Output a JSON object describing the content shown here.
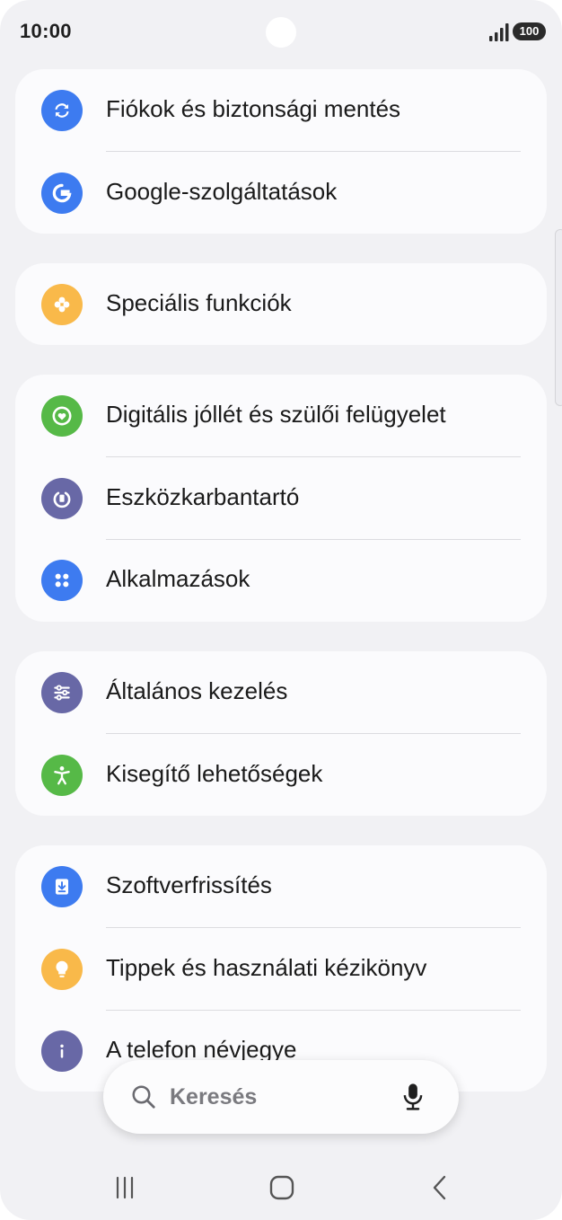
{
  "status_bar": {
    "time": "10:00",
    "battery": "100"
  },
  "groups": [
    {
      "items": [
        {
          "label": "Fiókok és biztonsági mentés",
          "icon": "sync-icon",
          "color": "#3d7bf0"
        },
        {
          "label": "Google-szolgáltatások",
          "icon": "google-icon",
          "color": "#3d7bf0"
        }
      ]
    },
    {
      "items": [
        {
          "label": "Speciális funkciók",
          "icon": "puzzle-icon",
          "color": "#f9b94a"
        }
      ]
    },
    {
      "items": [
        {
          "label": "Digitális jóllét és szülői felügyelet",
          "icon": "heart-icon",
          "color": "#56b947"
        },
        {
          "label": "Eszközkarbantartó",
          "icon": "device-care-icon",
          "color": "#6868a6"
        },
        {
          "label": "Alkalmazások",
          "icon": "apps-icon",
          "color": "#3d7bf0"
        }
      ]
    },
    {
      "items": [
        {
          "label": "Általános kezelés",
          "icon": "sliders-icon",
          "color": "#6868a6"
        },
        {
          "label": "Kisegítő lehetőségek",
          "icon": "accessibility-icon",
          "color": "#56b947"
        }
      ]
    },
    {
      "items": [
        {
          "label": "Szoftverfrissítés",
          "icon": "download-icon",
          "color": "#3d7bf0"
        },
        {
          "label": "Tippek és használati kézikönyv",
          "icon": "lightbulb-icon",
          "color": "#f9b94a"
        },
        {
          "label": "A telefon névjegye",
          "icon": "info-icon",
          "color": "#6868a6"
        }
      ]
    }
  ],
  "search": {
    "placeholder": "Keresés"
  }
}
